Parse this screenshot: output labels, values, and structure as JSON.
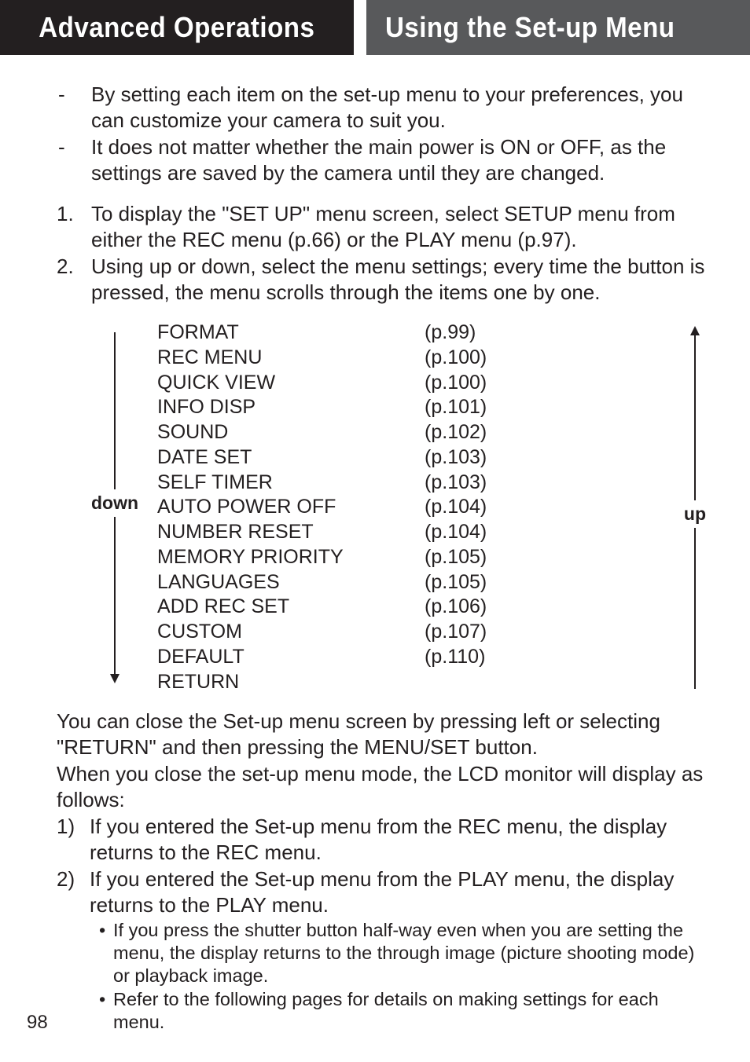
{
  "header": {
    "left": "Advanced Operations",
    "right": "Using the Set-up Menu"
  },
  "intro": [
    "By setting each item on the set-up menu to your preferences, you can customize your camera to suit you.",
    "It does not matter whether the main power is ON or OFF, as the settings are saved by the camera until they are changed."
  ],
  "steps": [
    "To display the \"SET UP\" menu screen, select SETUP menu from either the REC menu (p.66) or the PLAY menu (p.97).",
    "Using up or down, select the menu settings; every time the button is pressed, the menu scrolls through the items one by one."
  ],
  "arrows": {
    "down": "down",
    "up": "up"
  },
  "menu": [
    {
      "name": "FORMAT",
      "page": "(p.99)"
    },
    {
      "name": "REC MENU",
      "page": "(p.100)"
    },
    {
      "name": "QUICK VIEW",
      "page": "(p.100)"
    },
    {
      "name": "INFO DISP",
      "page": "(p.101)"
    },
    {
      "name": "SOUND",
      "page": "(p.102)"
    },
    {
      "name": "DATE SET",
      "page": "(p.103)"
    },
    {
      "name": "SELF TIMER",
      "page": "(p.103)"
    },
    {
      "name": "AUTO POWER OFF",
      "page": "(p.104)"
    },
    {
      "name": "NUMBER RESET",
      "page": "(p.104)"
    },
    {
      "name": "MEMORY PRIORITY",
      "page": "(p.105)"
    },
    {
      "name": "LANGUAGES",
      "page": "(p.105)"
    },
    {
      "name": "ADD REC SET",
      "page": "(p.106)"
    },
    {
      "name": "CUSTOM",
      "page": "(p.107)"
    },
    {
      "name": "DEFAULT",
      "page": "(p.110)"
    },
    {
      "name": "RETURN",
      "page": ""
    }
  ],
  "closing_p1": "You can close the Set-up menu screen by pressing left or selecting \"RETURN\" and then pressing the MENU/SET button.",
  "closing_p2": "When you close the set-up menu mode, the LCD monitor will display as follows:",
  "closing_list": [
    "If you entered the Set-up menu from the REC menu, the display returns to the REC menu.",
    "If you entered the Set-up menu from the PLAY menu, the display returns to the PLAY menu."
  ],
  "bullets": [
    "If you press the shutter button half-way even when you are setting the menu, the display returns to the through image (picture shooting mode) or playback image.",
    "Refer to the following pages for details on making settings for each menu."
  ],
  "page_number": "98"
}
